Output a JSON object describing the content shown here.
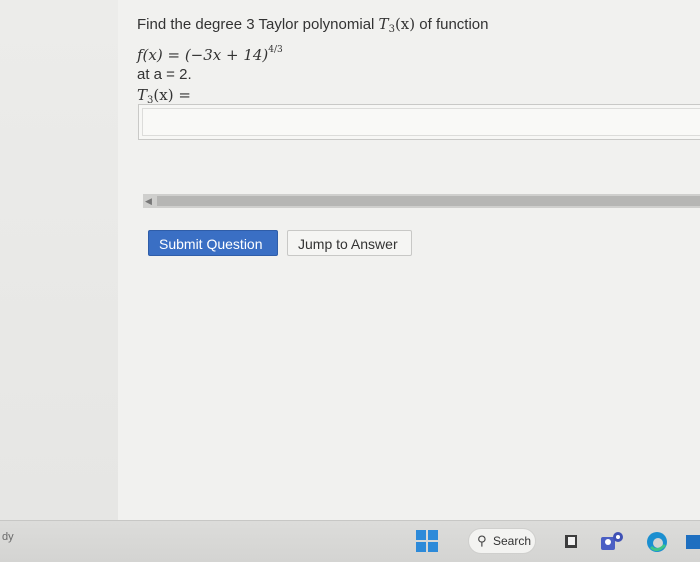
{
  "question": {
    "prompt_text": "Find the degree 3 Taylor polynomial",
    "prompt_symbol": "T",
    "prompt_symbol_sub": "3",
    "prompt_arg": "(x)",
    "prompt_suffix": "of function",
    "function_lhs": "f(x) = (−3x + 14)",
    "function_exponent": "4/3",
    "point_text": "at a = 2.",
    "answer_label_symbol": "T",
    "answer_label_sub": "3",
    "answer_label_rest": "(x) ="
  },
  "answer_input": {
    "value": ""
  },
  "buttons": {
    "submit_label": "Submit Question",
    "jump_label": "Jump to Answer"
  },
  "taskbar": {
    "left_text": "dy",
    "search_label": "Search"
  },
  "colors": {
    "submit_bg": "#3a6fc4",
    "windows_blue": "#2d8ad9"
  }
}
